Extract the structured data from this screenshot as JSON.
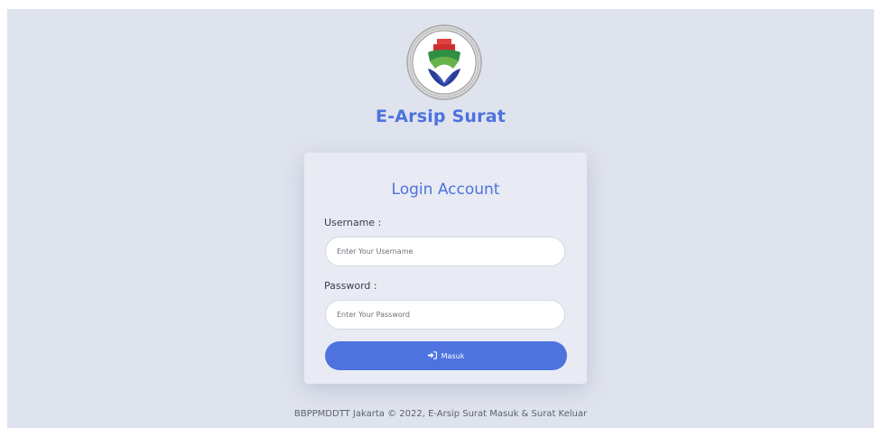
{
  "app": {
    "title": "E-Arsip Surat"
  },
  "login": {
    "heading": "Login Account",
    "username_label": "Username :",
    "username_placeholder": "Enter Your Username",
    "username_value": "",
    "password_label": "Password :",
    "password_placeholder": "Enter Your Password",
    "password_value": "",
    "submit_label": "Masuk",
    "submit_icon": "sign-in-icon"
  },
  "footer": {
    "text": "BBPPMDDTT Jakarta © 2022, E-Arsip Surat Masuk & Surat Keluar"
  },
  "colors": {
    "page_background": "#dfe3ee",
    "card_background": "#e8ebf3",
    "accent": "#4e73df",
    "text_dark": "#3a3f4a",
    "footer_text": "#5c616c"
  },
  "icons": [
    "institution-logo-icon",
    "sign-in-icon"
  ]
}
